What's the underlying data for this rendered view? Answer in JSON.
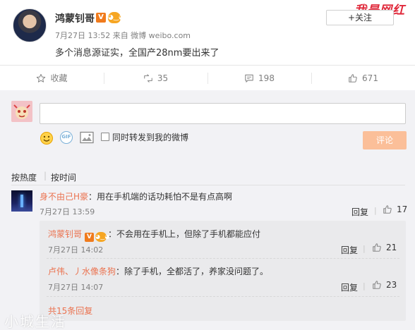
{
  "post": {
    "author": "鸿蒙钊哥",
    "verified_badge": "V",
    "meta": "7月27日 13:52 来自 微博 weibo.com",
    "text": "多个消息源证实，全国产28nm要出来了",
    "follow_label": "+关注"
  },
  "watermark_top": "我是网红",
  "actions": [
    {
      "icon": "star-icon",
      "label": "收藏"
    },
    {
      "icon": "forward-icon",
      "label": "35"
    },
    {
      "icon": "comment-icon",
      "label": "198"
    },
    {
      "icon": "thumbs-up-icon",
      "label": "671"
    }
  ],
  "composer": {
    "input_value": "",
    "forward_label": "同时转发到我的微博",
    "submit_label": "评论",
    "tools": [
      "emoji-icon",
      "gif-icon",
      "image-icon"
    ]
  },
  "sort": {
    "hot": "按热度",
    "separator": "|",
    "time": "按时间"
  },
  "comments": [
    {
      "user": "身不由己H豪",
      "text": "：用在手机端的话功耗怕不是有点高啊",
      "time": "7月27日 13:59",
      "reply_label": "回复",
      "separator": "|",
      "likes": "17"
    }
  ],
  "replies": [
    {
      "user": "鸿蒙钊哥",
      "verified_badge": "V",
      "text": "：不会用在手机上，但除了手机都能应付",
      "time": "7月27日 14:02",
      "reply_label": "回复",
      "separator": "|",
      "likes": "21"
    },
    {
      "user": "卢伟、丿水像条狗",
      "text": "：除了手机，全都活了，养家没问题了。",
      "time": "7月27日 14:07",
      "reply_label": "回复",
      "separator": "|",
      "likes": "23"
    }
  ],
  "more_replies": "共15条回复",
  "watermark_bottom": "小城生活",
  "colors": {
    "accent_orange": "#eb7350",
    "submit_disabled": "#fbbf99",
    "verified": "#f07b1d",
    "comment_bg": "#f2f2f5"
  }
}
